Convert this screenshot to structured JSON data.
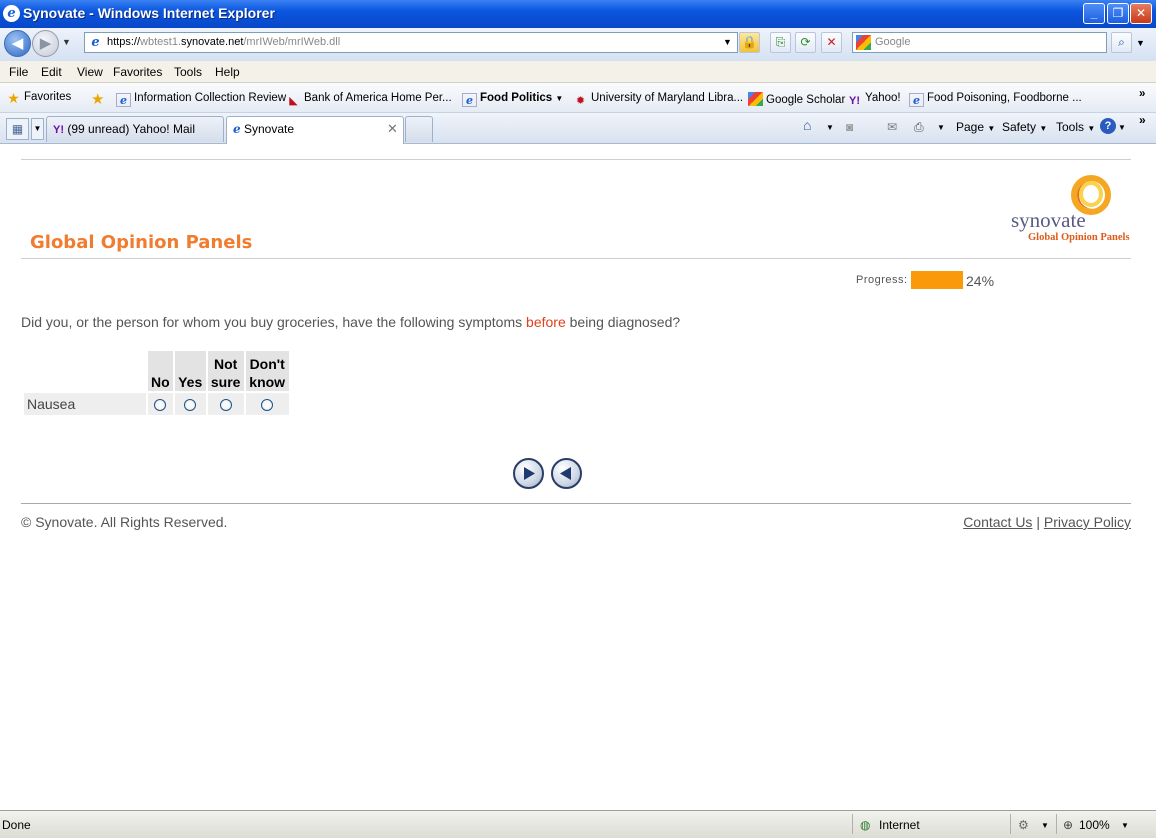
{
  "window": {
    "title": "Synovate - Windows Internet Explorer",
    "minimize": "_",
    "maximize": "❐",
    "close": "✕"
  },
  "address": {
    "scheme": "https://",
    "host_prefix": "wbtest1.",
    "host_main": "synovate.net",
    "path": "/mrIWeb/mrIWeb.dll",
    "search_placeholder": "Google"
  },
  "menu": [
    "File",
    "Edit",
    "View",
    "Favorites",
    "Tools",
    "Help"
  ],
  "favorites": {
    "label": "Favorites",
    "items": [
      "Information Collection Review",
      "Bank of America  Home  Per...",
      "Food Politics",
      "University of Maryland Libra...",
      "Google Scholar",
      "Yahoo!",
      "Food Poisoning, Foodborne ..."
    ]
  },
  "tabs": [
    {
      "label": "(99 unread) Yahoo! Mail"
    },
    {
      "label": "Synovate"
    }
  ],
  "commands": {
    "page": "Page",
    "safety": "Safety",
    "tools": "Tools"
  },
  "page": {
    "brand_title": "Global Opinion Panels",
    "logo_word": "synovate",
    "logo_sub": "Global Opinion Panels",
    "progress_label": "Progress:",
    "progress_fraction": 0.24,
    "progress_text": "24%",
    "question_before": "Did you, or the person for whom you buy groceries, have the following symptoms ",
    "question_highlight": "before",
    "question_after": " being diagnosed?",
    "columns": [
      "No",
      "Yes",
      "Not sure",
      "Don't know"
    ],
    "rows": [
      "Nausea"
    ],
    "copyright": "© Synovate. All Rights Reserved.",
    "contact": "Contact Us",
    "divider": " | ",
    "privacy": "Privacy Policy"
  },
  "status": {
    "text": "Done",
    "zone": "Internet",
    "zoom": "100%"
  },
  "colors": {
    "brand_orange": "#f07d2f",
    "progress_fill": "#fa9a0a",
    "highlight": "#e0401a"
  }
}
